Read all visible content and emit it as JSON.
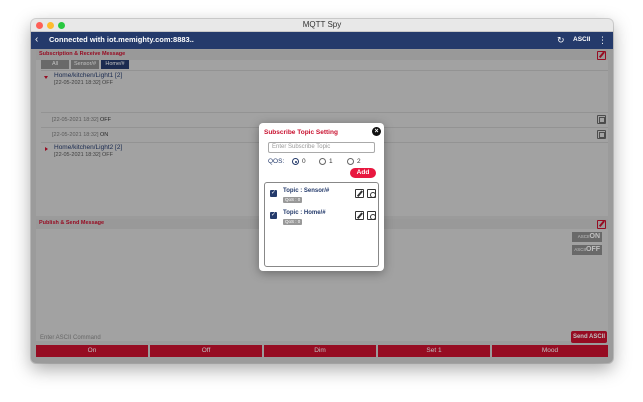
{
  "window": {
    "title": "MQTT Spy"
  },
  "appbar": {
    "back": "‹",
    "connection": "Connected with iot.memighty.com:8883..",
    "refresh": "↻",
    "ascii": "ASCII",
    "more": "⋮"
  },
  "subscribe_panel": {
    "title": "Subscription & Receive Message",
    "filters": [
      "All",
      "Sensor/#",
      "Home/#"
    ],
    "topics": [
      {
        "name": "Home/kitchen/Light1 [2]",
        "latest": "[22-05-2021 18:32] OFF"
      },
      {
        "name": "Home/kitchen/Light2 [2]",
        "latest": "[22-05-2021 18:32] OFF"
      }
    ],
    "messages": [
      {
        "time": "[22-05-2021 18:32]",
        "value": "OFF"
      },
      {
        "time": "[22-05-2021 18:32]",
        "value": "ON"
      }
    ]
  },
  "publish_panel": {
    "title": "Publish & Send Message",
    "ascii_on_prefix": "ASCII",
    "ascii_on": "ON",
    "ascii_off_prefix": "ASCII",
    "ascii_off": "OFF",
    "input_placeholder": "Enter ASCII Command",
    "send_label": "Send ASCII"
  },
  "commands": [
    "On",
    "Off",
    "Dim",
    "Set 1",
    "Mood"
  ],
  "modal": {
    "title": "Subscribe Topic Setting",
    "close": "×",
    "input_placeholder": "Enter Subscribe Topic",
    "qos_label": "QOS:",
    "qos_options": [
      "0",
      "1",
      "2"
    ],
    "qos_selected": "0",
    "add_label": "Add",
    "subscriptions": [
      {
        "topic": "Topic : Sensor/#",
        "qos": "QoS : 0",
        "checked": true
      },
      {
        "topic": "Topic : Home/#",
        "qos": "QoS : 0",
        "checked": true
      }
    ]
  },
  "colors": {
    "navy": "#243a6b",
    "red": "#c8102e",
    "add_red": "#e8173f"
  }
}
